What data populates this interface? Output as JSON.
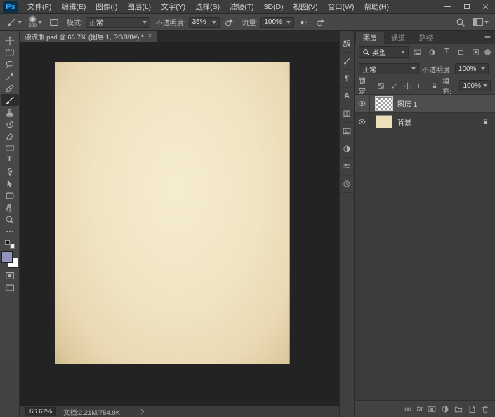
{
  "menu_bar": {
    "logo": "Ps",
    "items": [
      "文件(F)",
      "编辑(E)",
      "图像(I)",
      "图层(L)",
      "文字(Y)",
      "选择(S)",
      "滤镜(T)",
      "3D(D)",
      "视图(V)",
      "窗口(W)",
      "帮助(H)"
    ]
  },
  "window_controls": [
    "minimize",
    "maximize",
    "close"
  ],
  "options_bar": {
    "tool": "brush",
    "brush_size": "200",
    "mode_label": "模式:",
    "mode_value": "正常",
    "opacity_label": "不透明度:",
    "opacity_value": "35%",
    "flow_label": "流量:",
    "flow_value": "100%",
    "right_icons": [
      "search",
      "workspace-switcher"
    ]
  },
  "document_tab": {
    "title": "漂流瓶.psd @ 66.7% (图层 1, RGB/8#) *",
    "close_label": "×"
  },
  "toolbar": {
    "tools": [
      "move",
      "rectangular-marquee",
      "lasso",
      "eyedropper",
      "spot-healing-brush",
      "brush",
      "clone-stamp",
      "history-brush",
      "eraser",
      "gradient",
      "type",
      "pen",
      "path-selection",
      "shape",
      "hand",
      "zoom"
    ],
    "active_tool": "brush",
    "type_glyph": "T",
    "foreground_color": "#9093bb",
    "background_color": "#ffffff"
  },
  "dock_icons": [
    "styles",
    "brush-settings",
    "paragraph",
    "character",
    "libraries",
    "clone-source",
    "adjustments",
    "properties",
    "history"
  ],
  "dock_glyphs": {
    "paragraph": "¶",
    "character": "A"
  },
  "layers_panel": {
    "tabs": [
      "图层",
      "通道",
      "路径"
    ],
    "filter_label": "类型",
    "filter_icons": [
      "pixel-layer-filter",
      "adjustment-layer-filter",
      "type-layer-filter",
      "shape-layer-filter",
      "smart-object-filter"
    ],
    "type_filter_glyph": "T",
    "blend_mode": "正常",
    "opacity_label": "不透明度:",
    "opacity_value": "100%",
    "lock_label": "锁定:",
    "lock_icons": [
      "lock-transparent-pixels",
      "lock-image-pixels",
      "lock-position",
      "lock-artboard",
      "lock-all"
    ],
    "fill_label": "填充:",
    "fill_value": "100%",
    "layers": [
      {
        "name": "图层 1",
        "selected": true,
        "thumbnail": "transparent"
      },
      {
        "name": "背景",
        "selected": false,
        "thumbnail": "#ece0b8",
        "locked": true
      }
    ],
    "fx_label": "fx",
    "bottom_icons": [
      "link-layers",
      "layer-style",
      "add-layer-mask",
      "new-adjustment-layer",
      "new-group",
      "new-layer",
      "delete-layer"
    ]
  },
  "status_bar": {
    "zoom": "66.67%",
    "doc_info": "文档:2.21M/754.9K"
  },
  "colors": {
    "accent_blue": "#31a8ff",
    "panel": "#424242",
    "pasteboard": "#232323",
    "canvas_paper": "#f0e4c2",
    "selected_row": "#4e4e4e",
    "foreground_swatch": "#9093bb"
  }
}
